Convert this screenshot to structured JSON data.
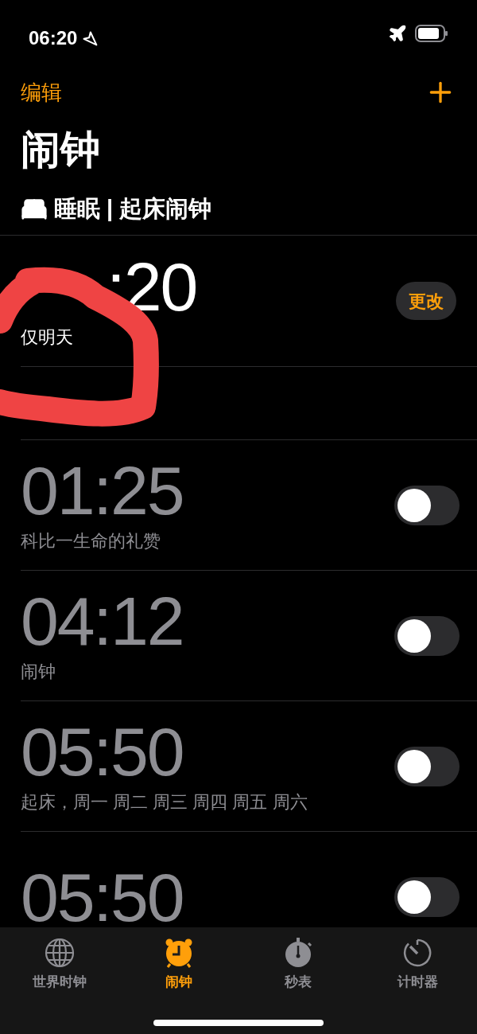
{
  "status_bar": {
    "time": "06:20"
  },
  "nav": {
    "edit": "编辑"
  },
  "title": "闹钟",
  "sleep": {
    "header": "睡眠 | 起床闹钟",
    "time": ":20",
    "label": "仅明天",
    "button": "更改"
  },
  "alarms": [
    {
      "time": "01:25",
      "label": "科比一生命的礼赞",
      "on": false
    },
    {
      "time": "04:12",
      "label": "闹钟",
      "on": false
    },
    {
      "time": "05:50",
      "label": "起床，周一 周二 周三 周四 周五 周六",
      "on": false
    },
    {
      "time": "05:50",
      "on": false
    }
  ],
  "tabs": [
    {
      "label": "世界时钟",
      "kind": "globe",
      "selected": false
    },
    {
      "label": "闹钟",
      "kind": "alarm",
      "selected": true
    },
    {
      "label": "秒表",
      "kind": "stopwatch",
      "selected": false
    },
    {
      "label": "计时器",
      "kind": "timer",
      "selected": false
    }
  ]
}
